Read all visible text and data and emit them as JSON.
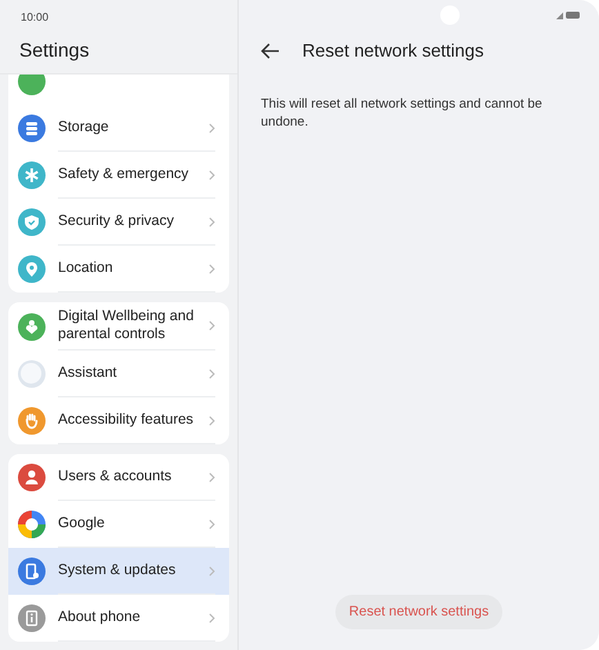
{
  "status_bar": {
    "time": "10:00"
  },
  "sidebar": {
    "title": "Settings",
    "groups": [
      {
        "items": [
          {
            "label": "Storage",
            "kind": "stack",
            "color": "#3b7ae0",
            "selected": false
          },
          {
            "label": "Safety & emergency",
            "kind": "asterisk",
            "color": "#3fb6c9",
            "selected": false
          },
          {
            "label": "Security & privacy",
            "kind": "shield",
            "color": "#3fb6c9",
            "selected": false
          },
          {
            "label": "Location",
            "kind": "pin",
            "color": "#3fb6c9",
            "selected": false
          }
        ]
      },
      {
        "items": [
          {
            "label": "Digital Wellbeing and parental controls",
            "kind": "heart",
            "color": "#4cb25a",
            "selected": false
          },
          {
            "label": "Assistant",
            "kind": "sphere",
            "color": "#dfe6ee",
            "selected": false
          },
          {
            "label": "Accessibility features",
            "kind": "hand",
            "color": "#f0982e",
            "selected": false
          }
        ]
      },
      {
        "items": [
          {
            "label": "Users & accounts",
            "kind": "person",
            "color": "#db4b3f",
            "selected": false
          },
          {
            "label": "Google",
            "kind": "ring",
            "color": "#4285f4",
            "selected": false
          },
          {
            "label": "System & updates",
            "kind": "phone",
            "color": "#3b7ae0",
            "selected": true
          },
          {
            "label": "About phone",
            "kind": "info",
            "color": "#9a9a9a",
            "selected": false
          }
        ]
      }
    ]
  },
  "detail": {
    "title": "Reset network settings",
    "text": "This will reset all network settings and cannot be undone.",
    "button": "Reset network settings"
  }
}
